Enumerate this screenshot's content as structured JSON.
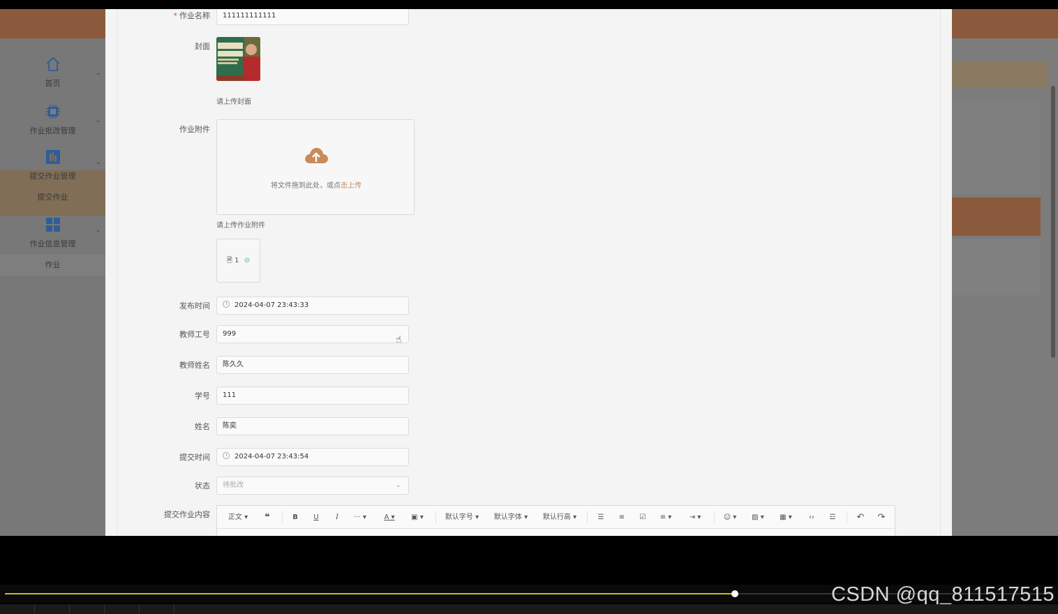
{
  "sidebar": {
    "items": [
      {
        "label": "首页",
        "icon": "home-icon"
      },
      {
        "label": "作业批改管理",
        "icon": "chip-icon"
      },
      {
        "label": "提交作业管理",
        "icon": "chart-icon"
      },
      {
        "label": "作业信息管理",
        "icon": "grid-icon"
      }
    ],
    "subitems": {
      "submit": "提交作业",
      "info": "作业"
    }
  },
  "form": {
    "name_label": "作业名称",
    "name_value": "111111111111",
    "cover_label": "封面",
    "cover_hint": "请上传封面",
    "attach_label": "作业附件",
    "upload_text": "将文件拖到此处，或点",
    "upload_link": "击上传",
    "attach_hint": "请上传作业附件",
    "file_name": "1",
    "publish_label": "发布时间",
    "publish_value": "2024-04-07 23:43:33",
    "teacher_id_label": "教师工号",
    "teacher_id_value": "999",
    "teacher_name_label": "教师姓名",
    "teacher_name_value": "陈久久",
    "student_id_label": "学号",
    "student_id_value": "111",
    "student_name_label": "姓名",
    "student_name_value": "陈奕",
    "submit_time_label": "提交时间",
    "submit_time_value": "2024-04-07 23:43:54",
    "status_label": "状态",
    "status_value": "待批改",
    "content_label": "提交作业内容"
  },
  "editor_toolbar": {
    "paragraph": "正文",
    "font_size": "默认字号",
    "font_family": "默认字体",
    "line_height": "默认行高"
  },
  "player": {
    "progress": 0.697,
    "watermark": "CSDN @qq_811517515"
  },
  "colors": {
    "accent": "#c98a5c",
    "header": "#8b5a3c",
    "progress": "#d9b51b"
  }
}
